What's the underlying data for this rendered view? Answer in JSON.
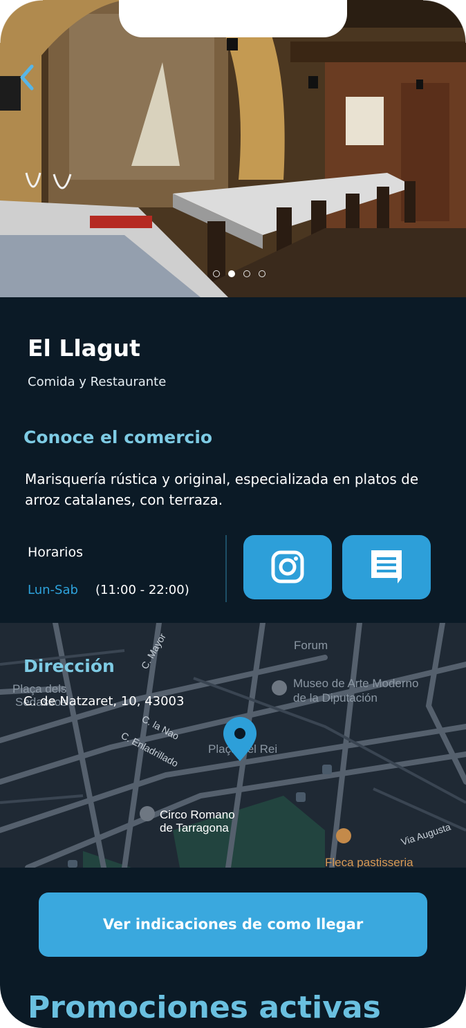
{
  "hero": {
    "pagination": {
      "count": 4,
      "active_index": 1
    }
  },
  "business": {
    "name": "El Llagut",
    "category": "Comida y Restaurante"
  },
  "about": {
    "heading": "Conoce el comercio",
    "description": "Marisquería rústica y original, especializada en platos de arroz catalanes, con terraza."
  },
  "hours": {
    "label": "Horarios",
    "days": "Lun-Sab",
    "time": "(11:00 - 22:00)"
  },
  "actions": {
    "instagram_icon": "instagram-icon",
    "chat_icon": "chat-icon"
  },
  "address": {
    "heading": "Dirección",
    "value": "C. de Natzaret, 10, 43003"
  },
  "map": {
    "labels": {
      "forum": "Forum",
      "museo_1": "Museo de Arte Moderno",
      "museo_2": "de la Diputación",
      "placa_1": "Plaça dels",
      "placa_2": "Sedassos",
      "c_mayor": "C. Mayor",
      "c_la_nao": "C. la Nao",
      "c_enadrillado": "C. Enladrillado",
      "playa_del_rei": "Plaça del Rei",
      "circo_1": "Circo Romano",
      "circo_2": "de Tarragona",
      "via_augusta": "Via Augusta",
      "fleca": "Fleca pastisseria"
    },
    "pin_color": "#2d9fd9"
  },
  "cta": {
    "label": "Ver indicaciones de como llegar"
  },
  "promotions": {
    "heading": "Promociones activas"
  },
  "colors": {
    "background": "#0b1a26",
    "accent": "#2d9fd9",
    "heading": "#7ecbe4"
  }
}
